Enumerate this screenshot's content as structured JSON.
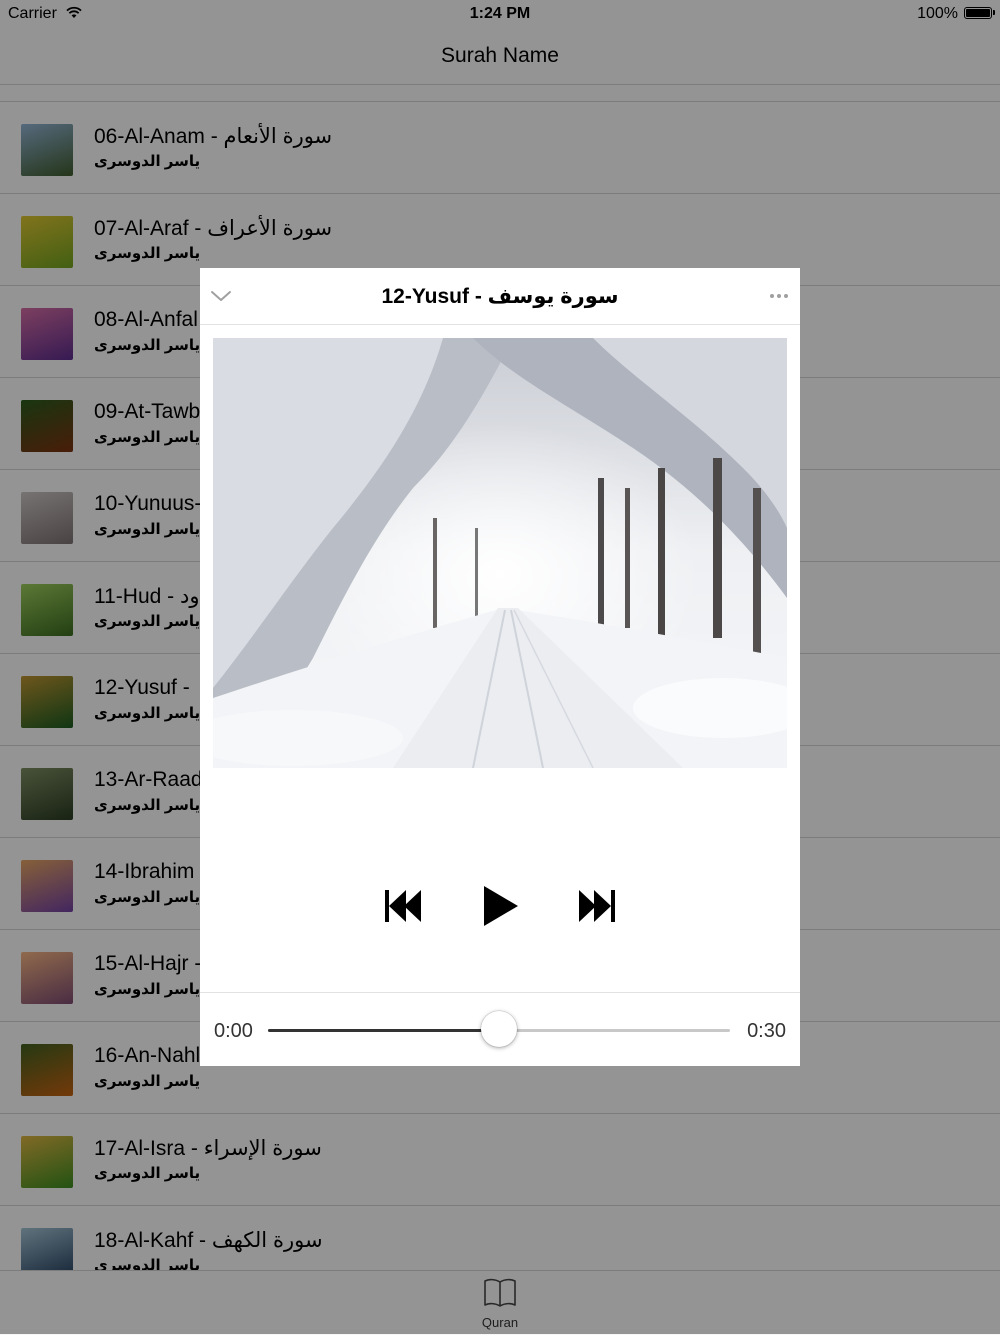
{
  "status_bar": {
    "carrier": "Carrier",
    "time": "1:24 PM",
    "battery": "100%"
  },
  "nav": {
    "title": "Surah Name"
  },
  "surahs": [
    {
      "title": "06-Al-Anam - سورة الأنعام",
      "reciter": "ياسر الدوسرى"
    },
    {
      "title": "07-Al-Araf - سورة الأعراف",
      "reciter": "ياسر الدوسرى"
    },
    {
      "title": "08-Al-Anfal",
      "reciter": "ياسر الدوسرى"
    },
    {
      "title": "09-At-Tawb",
      "reciter": "ياسر الدوسرى"
    },
    {
      "title": "10-Yunuus-",
      "reciter": "ياسر الدوسرى"
    },
    {
      "title": "11-Hud - ود",
      "reciter": "ياسر الدوسرى"
    },
    {
      "title": "12-Yusuf - ",
      "reciter": "ياسر الدوسرى"
    },
    {
      "title": "13-Ar-Raad",
      "reciter": "ياسر الدوسرى"
    },
    {
      "title": "14-Ibrahim",
      "reciter": "ياسر الدوسرى"
    },
    {
      "title": "15-Al-Hajr -",
      "reciter": "ياسر الدوسرى"
    },
    {
      "title": "16-An-Nahl",
      "reciter": "ياسر الدوسرى"
    },
    {
      "title": "17-Al-Isra - سورة الإسراء",
      "reciter": "ياسر الدوسرى"
    },
    {
      "title": "18-Al-Kahf - سورة الكهف",
      "reciter": "ياسر الدوسرى"
    }
  ],
  "thumb_colors": [
    [
      "#3e5a2c",
      "#8fb0d0"
    ],
    [
      "#6fa020",
      "#d8c030"
    ],
    [
      "#5a2c8a",
      "#d06aa0"
    ],
    [
      "#7a3010",
      "#2a5a1c"
    ],
    [
      "#7a7070",
      "#c8c0c0"
    ],
    [
      "#3a6a20",
      "#9ac85a"
    ],
    [
      "#1a5a20",
      "#b89030"
    ],
    [
      "#2a3a20",
      "#7a8a60"
    ],
    [
      "#7040a0",
      "#e0a060"
    ],
    [
      "#7a4a70",
      "#f0b080"
    ],
    [
      "#c06010",
      "#406020"
    ],
    [
      "#3a8a20",
      "#d8b040"
    ],
    [
      "#203a5a",
      "#a0c0d0"
    ]
  ],
  "player": {
    "title": "12-Yusuf - سورة يوسف",
    "artwork": "snowy-forest-path",
    "time_elapsed": "0:00",
    "time_total": "0:30",
    "progress": 0.5
  },
  "tabs": [
    {
      "label": "Quran",
      "icon": "book-icon"
    }
  ]
}
